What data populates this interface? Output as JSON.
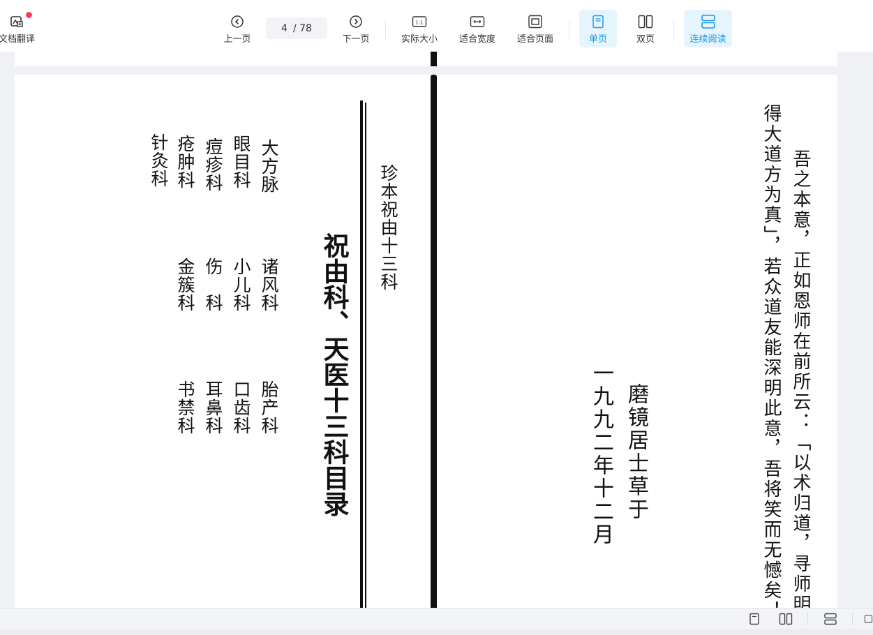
{
  "toolbar": {
    "doc_translate_label": "文档翻译",
    "prev_label": "上一页",
    "page_current": "4",
    "page_total": "/ 78",
    "next_label": "下一页",
    "actual_size_label": "实际大小",
    "fit_width_label": "适合宽度",
    "fit_page_label": "适合页面",
    "single_page_label": "单页",
    "double_page_label": "双页",
    "continuous_label": "连续阅读",
    "actual_size_glyph": "1:1",
    "accent_color": "#1a9be8"
  },
  "page": {
    "left": {
      "spine_title": "珍本祝由十三科",
      "main_title": "祝由科、天医十三科目录",
      "columns": [
        {
          "top": "大方脉",
          "mid": "诸风科",
          "bottom": "胎产科"
        },
        {
          "top": "眼目科",
          "mid": "小儿科",
          "bottom": "口齿科"
        },
        {
          "top": "痘疹科",
          "mid": "伤　科",
          "bottom": "耳鼻科"
        },
        {
          "top": "疮肿科",
          "mid": "金簇科",
          "bottom": "书禁科"
        },
        {
          "top": "针灸科",
          "mid": "",
          "bottom": ""
        }
      ]
    },
    "right": {
      "text_col1": "吾之本意，正如恩师在前所云：「以术归道，寻师明窍",
      "text_col2": "得大道方为真」，若众道友能深明此意，吾将笑而无憾矣！",
      "signature": "磨镜居士草于",
      "date": "一九九二年十二月"
    }
  }
}
